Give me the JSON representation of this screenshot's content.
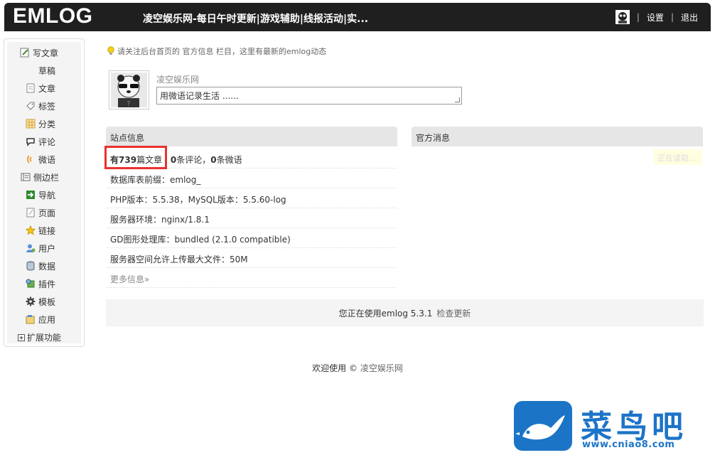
{
  "header": {
    "logo": "EMLOG",
    "site_title": "凌空娱乐网-每日午时更新|游戏辅助|线报活动|实...",
    "settings": "设置",
    "logout": "退出",
    "separator": "|"
  },
  "sidebar": {
    "items": [
      {
        "label": "写文章",
        "icon": "pencil-icon"
      },
      {
        "label": "草稿",
        "icon": ""
      },
      {
        "label": "文章",
        "icon": "document-icon"
      },
      {
        "label": "标签",
        "icon": "tag-icon"
      },
      {
        "label": "分类",
        "icon": "grid-icon"
      },
      {
        "label": "评论",
        "icon": "comment-icon"
      },
      {
        "label": "微语",
        "icon": "broadcast-icon"
      },
      {
        "label": "侧边栏",
        "icon": "sidebar-icon"
      },
      {
        "label": "导航",
        "icon": "arrow-right-icon"
      },
      {
        "label": "页面",
        "icon": "page-icon"
      },
      {
        "label": "链接",
        "icon": "star-icon"
      },
      {
        "label": "用户",
        "icon": "user-icon"
      },
      {
        "label": "数据",
        "icon": "database-icon"
      },
      {
        "label": "插件",
        "icon": "plugin-icon"
      },
      {
        "label": "模板",
        "icon": "gear-icon"
      },
      {
        "label": "应用",
        "icon": "app-icon"
      },
      {
        "label": "扩展功能",
        "icon": "expand-icon"
      }
    ]
  },
  "notice": "请关注后台首页的 官方信息 栏目，这里有最新的emlog动态",
  "twitter": {
    "nickname": "凌空娱乐网",
    "placeholder": "用微语记录生活 ......"
  },
  "site_info": {
    "title": "站点信息",
    "articles_prefix": "有",
    "articles_count": "739",
    "articles_suffix": "篇文章",
    "comments_count": "0",
    "comments_label": "条评论，",
    "twitters_count": "0",
    "twitters_label": "条微语",
    "db_prefix": "数据库表前缀：emlog_",
    "php_version": "PHP版本：5.5.38，MySQL版本：5.5.60-log",
    "server_env": "服务器环境：nginx/1.8.1",
    "gd_lib": "GD图形处理库：bundled (2.1.0 compatible)",
    "max_upload": "服务器空间允许上传最大文件：50M",
    "more": "更多信息»"
  },
  "official": {
    "title": "官方消息",
    "loading": "正在读取..."
  },
  "version": {
    "text": "您正在使用emlog 5.3.1",
    "check_update": "检查更新"
  },
  "footer": {
    "text": "欢迎使用 ©",
    "link": "凌空娱乐网"
  },
  "watermark": {
    "name": "菜鸟吧",
    "url": "www.cniao8.com"
  },
  "colors": {
    "header_bg": "#1f1f1f",
    "highlight": "#e8322e",
    "watermark": "#1c74c7"
  }
}
